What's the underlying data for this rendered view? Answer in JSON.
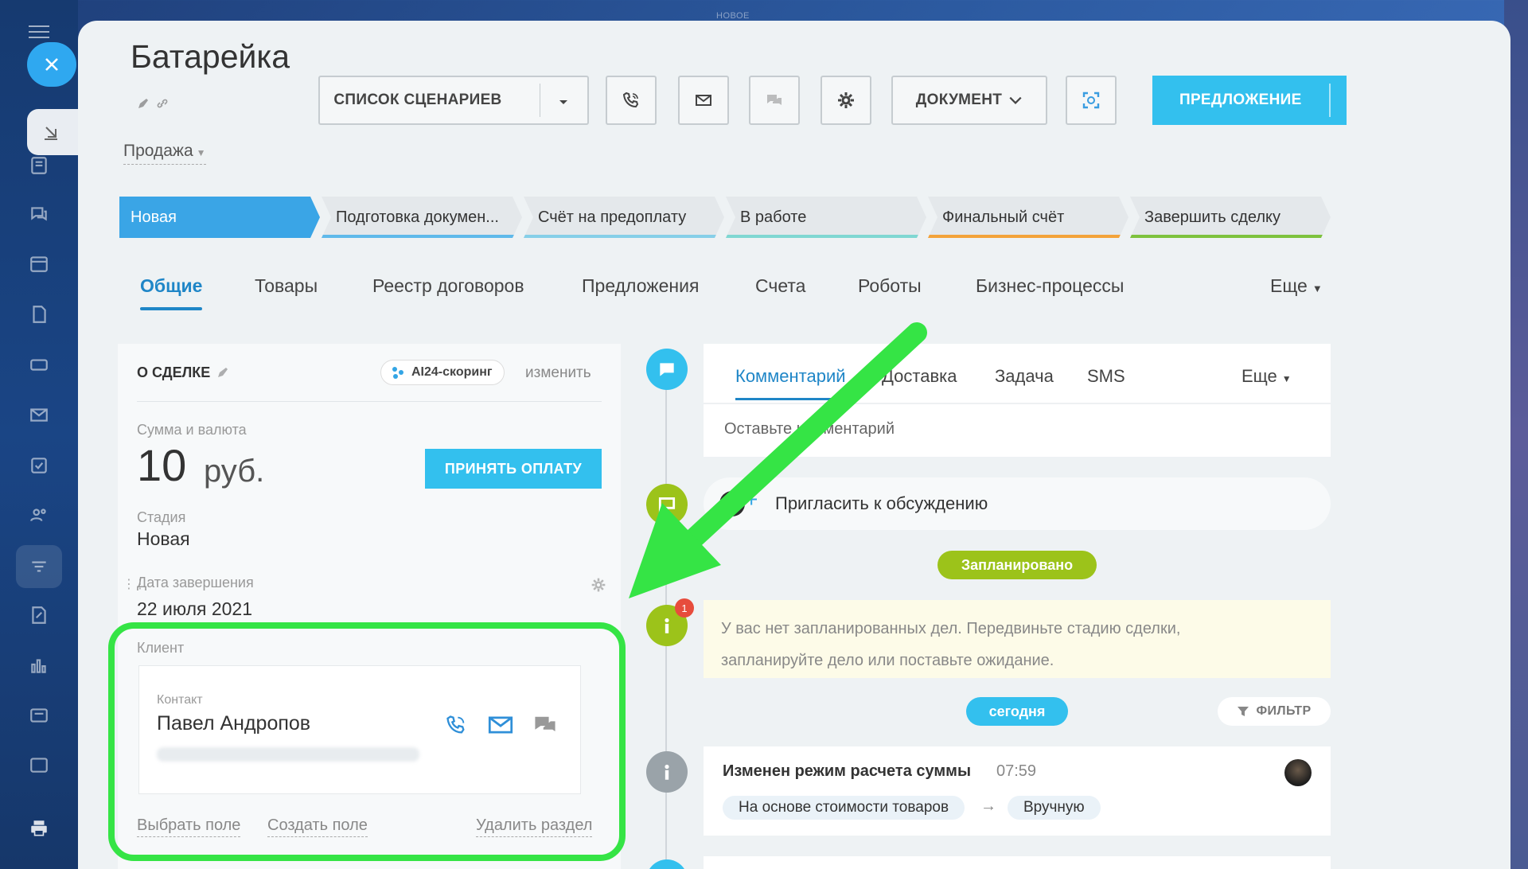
{
  "top_label": "НОВОЕ",
  "deal": {
    "title": "Батарейка",
    "category": "Продажа"
  },
  "toolbar": {
    "scenarios_label": "СПИСОК СЦЕНАРИЕВ",
    "document_label": "ДОКУМЕНТ",
    "primary_label": "ПРЕДЛОЖЕНИЕ"
  },
  "stages": [
    {
      "label": "Новая",
      "color": "#3aa5e6"
    },
    {
      "label": "Подготовка докумен...",
      "color": "#5fb9ea"
    },
    {
      "label": "Счёт на предоплату",
      "color": "#86cfe8"
    },
    {
      "label": "В работе",
      "color": "#7fd7d2"
    },
    {
      "label": "Финальный счёт",
      "color": "#f3a33a"
    },
    {
      "label": "Завершить сделку",
      "color": "#7dc23d"
    }
  ],
  "tabs": [
    "Общие",
    "Товары",
    "Реестр договоров",
    "Предложения",
    "Счета",
    "Роботы",
    "Бизнес-процессы",
    "Еще"
  ],
  "about": {
    "header": "О СДЕЛКЕ",
    "ai_badge": "AI24-скоринг",
    "change_link": "изменить",
    "amount_label": "Сумма и валюта",
    "amount": "10",
    "currency": "руб.",
    "pay_button": "ПРИНЯТЬ ОПЛАТУ",
    "stage_label": "Стадия",
    "stage_value": "Новая",
    "close_date_label": "Дата завершения",
    "close_date_value": "22 июля 2021",
    "client_label": "Клиент",
    "contact_label": "Контакт",
    "contact_name": "Павел Андропов",
    "select_field": "Выбрать поле",
    "create_field": "Создать поле",
    "delete_section": "Удалить раздел"
  },
  "timeline": {
    "tabs": [
      "Комментарий",
      "Доставка",
      "Задача",
      "SMS",
      "Еще"
    ],
    "comment_placeholder": "Оставьте комментарий",
    "invite_text": "Пригласить к обсуждению",
    "planned_pill": "Запланировано",
    "notice_line1": "У вас нет запланированных дел. Передвиньте стадию сделки,",
    "notice_line2": "запланируйте дело или поставьте ожидание.",
    "notice_badge": "1",
    "today_pill": "сегодня",
    "filter_label": "ФИЛЬТР",
    "history_title": "Изменен режим расчета суммы",
    "history_time": "07:59",
    "history_from": "На основе стоимости товаров",
    "history_to": "Вручную"
  },
  "colors": {
    "accent_blue": "#33c0ee",
    "link_blue": "#1f86c7",
    "timeline_green": "#9cc31a",
    "highlight_green": "#35e445"
  }
}
